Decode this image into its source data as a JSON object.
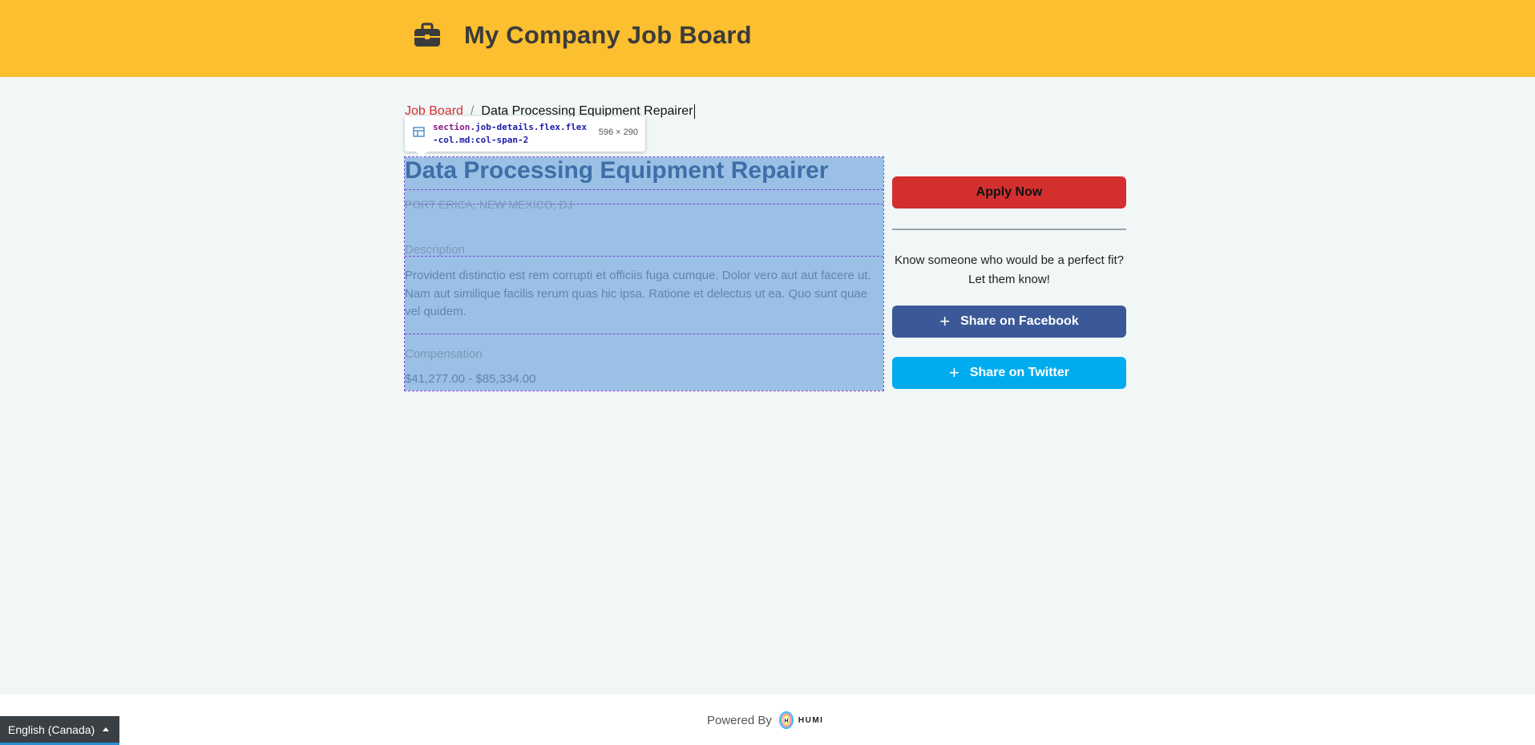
{
  "header": {
    "title": "My Company Job Board",
    "icon": "briefcase-icon",
    "background": "#fbbf2f"
  },
  "breadcrumb": {
    "root": "Job Board",
    "separator": "/",
    "current": "Data Processing Equipment Repairer"
  },
  "devtools_tooltip": {
    "selector_tag": "section",
    "selector_classes": ".job-details.flex.flex-col.md:col-span-2",
    "dimensions": "596 × 290"
  },
  "job": {
    "title": "Data Processing Equipment Repairer",
    "location": "PORT ERICA, NEW MEXICO, DJ",
    "description_label": "Description",
    "description": "Provident distinctio est rem corrupti et officiis fuga cumque. Dolor vero aut aut facere ut. Nam aut similique facilis rerum quas hic ipsa. Ratione et delectus ut ea. Quo sunt quae vel quidem.",
    "compensation_label": "Compensation",
    "compensation": "$41,277.00 - $85,334.00"
  },
  "sidebar": {
    "apply_label": "Apply Now",
    "share_prompt": "Know someone who would be a perfect fit? Let them know!",
    "facebook_label": "Share on Facebook",
    "twitter_label": "Share on Twitter",
    "colors": {
      "apply": "#d42f2f",
      "facebook": "#3b5998",
      "twitter": "#00acee"
    }
  },
  "footer": {
    "powered_by": "Powered By",
    "brand": "HUMI"
  },
  "language_selector": {
    "label": "English (Canada)"
  }
}
